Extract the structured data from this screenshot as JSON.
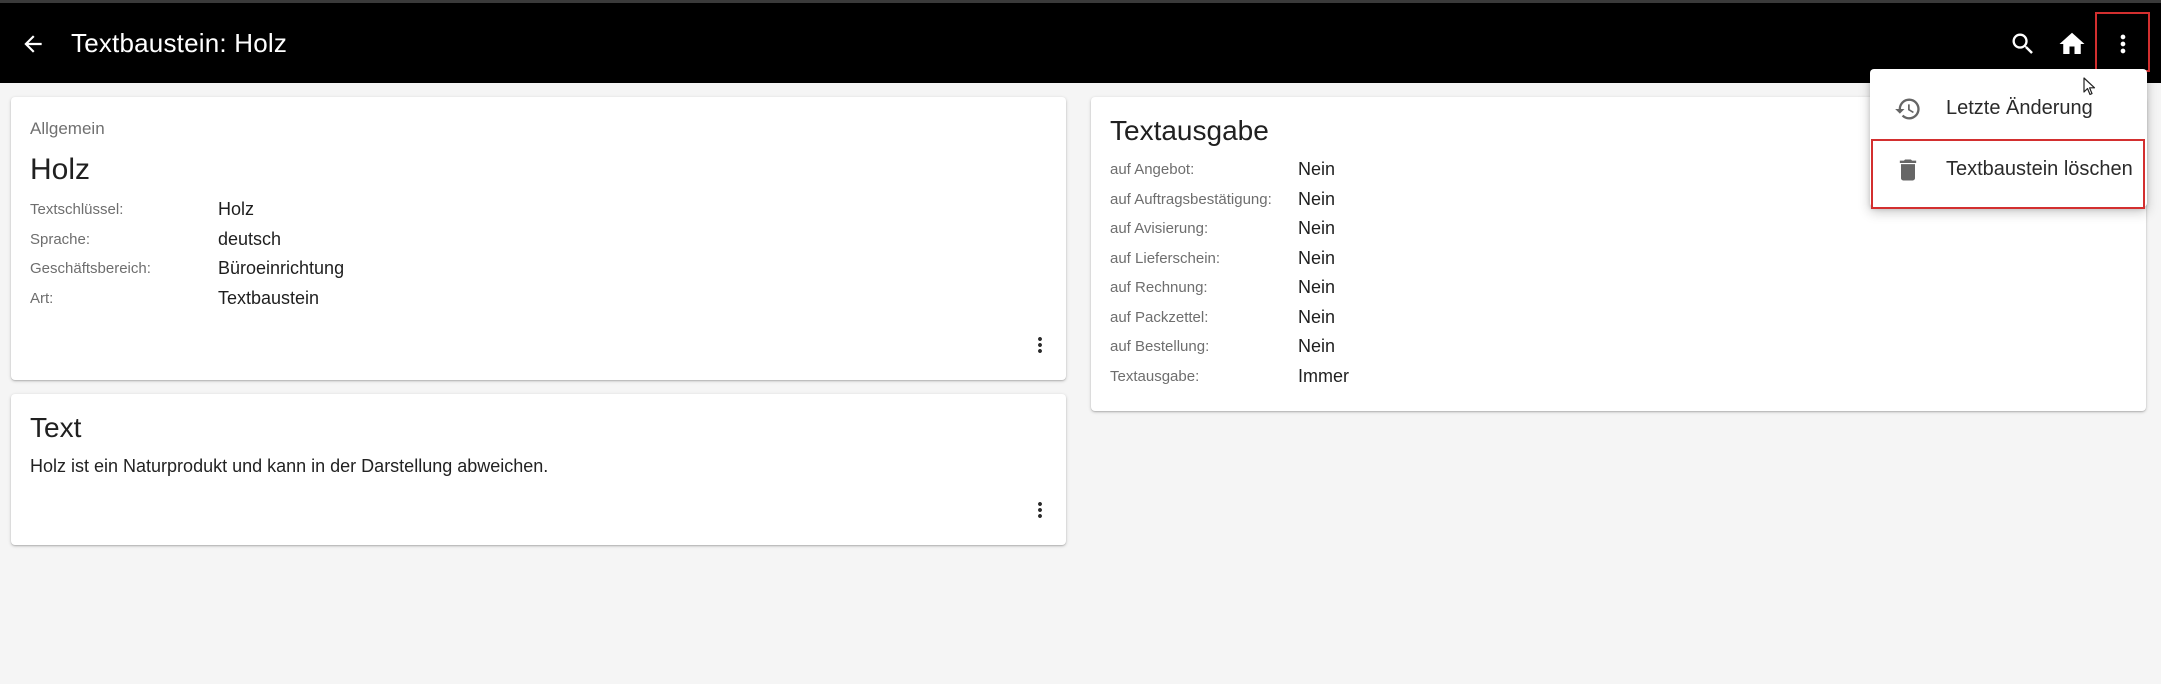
{
  "header": {
    "title": "Textbaustein: Holz",
    "back_icon": "arrow-left-icon",
    "search_icon": "search-icon",
    "home_icon": "home-icon",
    "more_icon": "more-vertical-icon",
    "background": "#000000"
  },
  "menu": {
    "items": [
      {
        "label": "Letzte Änderung",
        "icon": "history-icon"
      },
      {
        "label": "Textbaustein löschen",
        "icon": "trash-icon"
      }
    ]
  },
  "general_card": {
    "overline": "Allgemein",
    "title": "Holz",
    "fields": [
      {
        "label": "Textschlüssel:",
        "value": "Holz"
      },
      {
        "label": "Sprache:",
        "value": "deutsch"
      },
      {
        "label": "Geschäftsbereich:",
        "value": "Büroeinrichtung"
      },
      {
        "label": "Art:",
        "value": "Textbaustein"
      }
    ]
  },
  "text_card": {
    "title": "Text",
    "content": "Holz ist ein Naturprodukt und kann in der Darstellung abweichen."
  },
  "output_card": {
    "title": "Textausgabe",
    "fields": [
      {
        "label": "auf Angebot:",
        "value": "Nein"
      },
      {
        "label": "auf Auftragsbestätigung:",
        "value": "Nein"
      },
      {
        "label": "auf Avisierung:",
        "value": "Nein"
      },
      {
        "label": "auf Lieferschein:",
        "value": "Nein"
      },
      {
        "label": "auf Rechnung:",
        "value": "Nein"
      },
      {
        "label": "auf Packzettel:",
        "value": "Nein"
      },
      {
        "label": "auf Bestellung:",
        "value": "Nein"
      },
      {
        "label": "Textausgabe:",
        "value": "Immer"
      }
    ]
  },
  "colors": {
    "highlight": "#d32f2f",
    "page_bg": "#f5f5f5"
  }
}
